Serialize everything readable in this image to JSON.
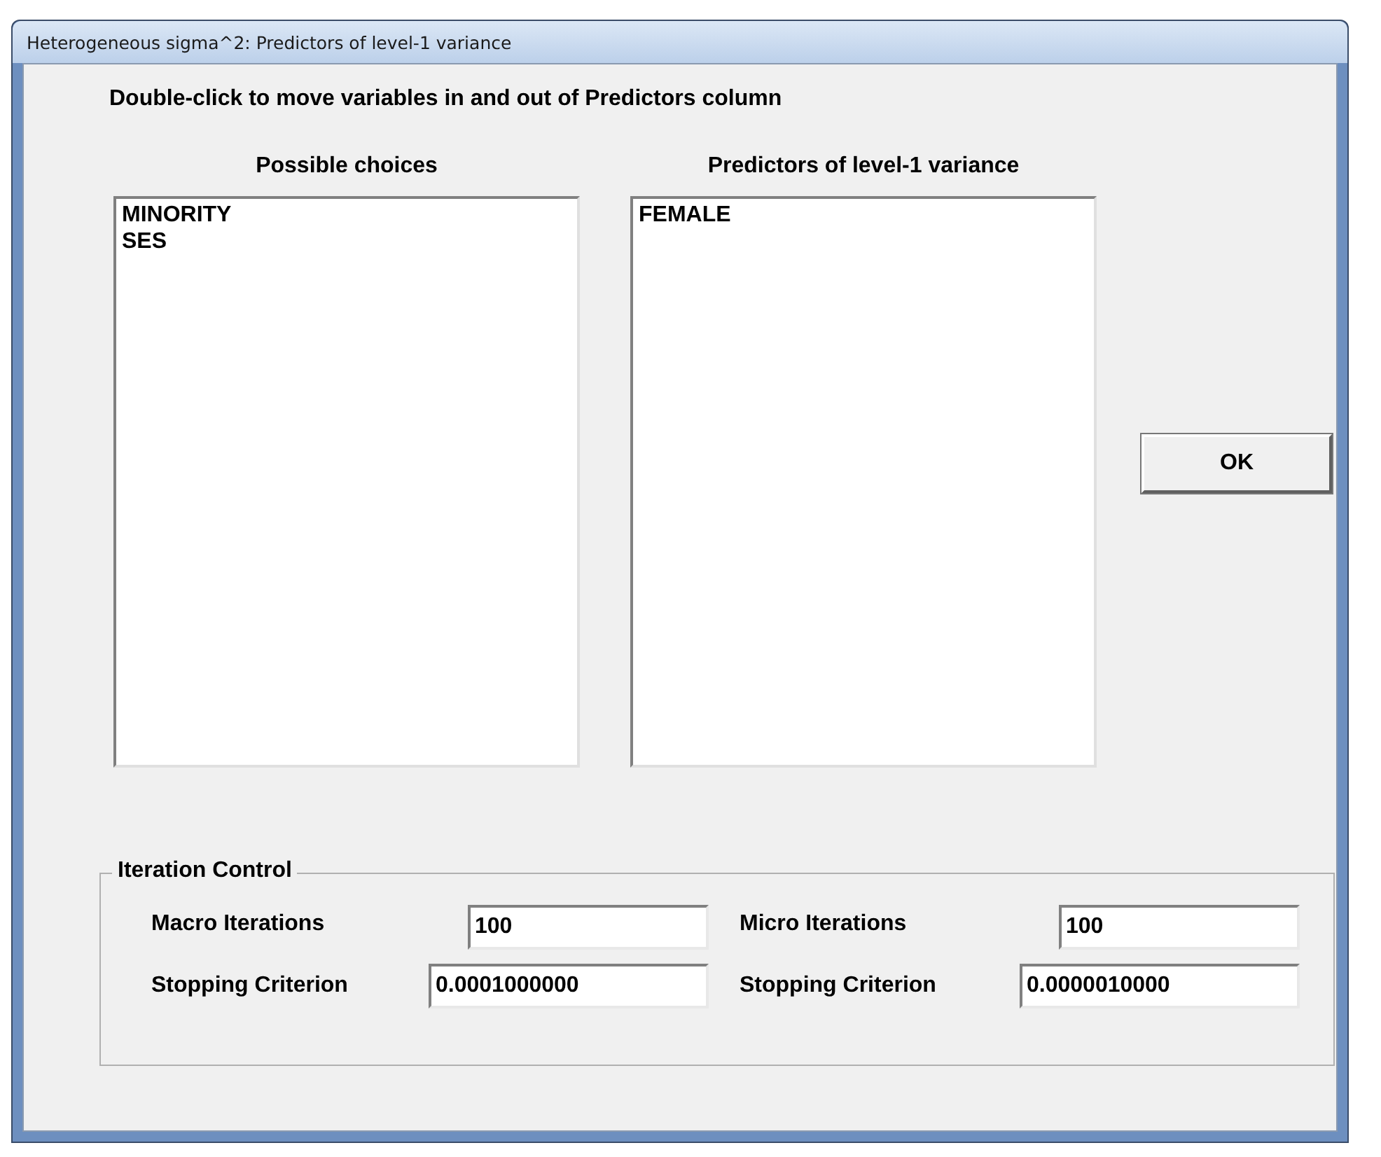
{
  "window": {
    "title": "Heterogeneous sigma^2: Predictors of level-1 variance"
  },
  "instruction": "Double-click to move variables in and out of Predictors column",
  "lists": [
    {
      "heading": "Possible choices",
      "items": [
        "MINORITY",
        "SES"
      ]
    },
    {
      "heading": "Predictors of level-1 variance",
      "items": [
        "FEMALE"
      ]
    }
  ],
  "ok_button": "OK",
  "iteration_control": {
    "title": "Iteration Control",
    "fields": [
      {
        "label": "Macro Iterations",
        "value": "100"
      },
      {
        "label": "Micro Iterations",
        "value": "100"
      },
      {
        "label": "Stopping Criterion",
        "value": "0.0001000000"
      },
      {
        "label": "Stopping Criterion",
        "value": "0.0000010000"
      }
    ]
  }
}
